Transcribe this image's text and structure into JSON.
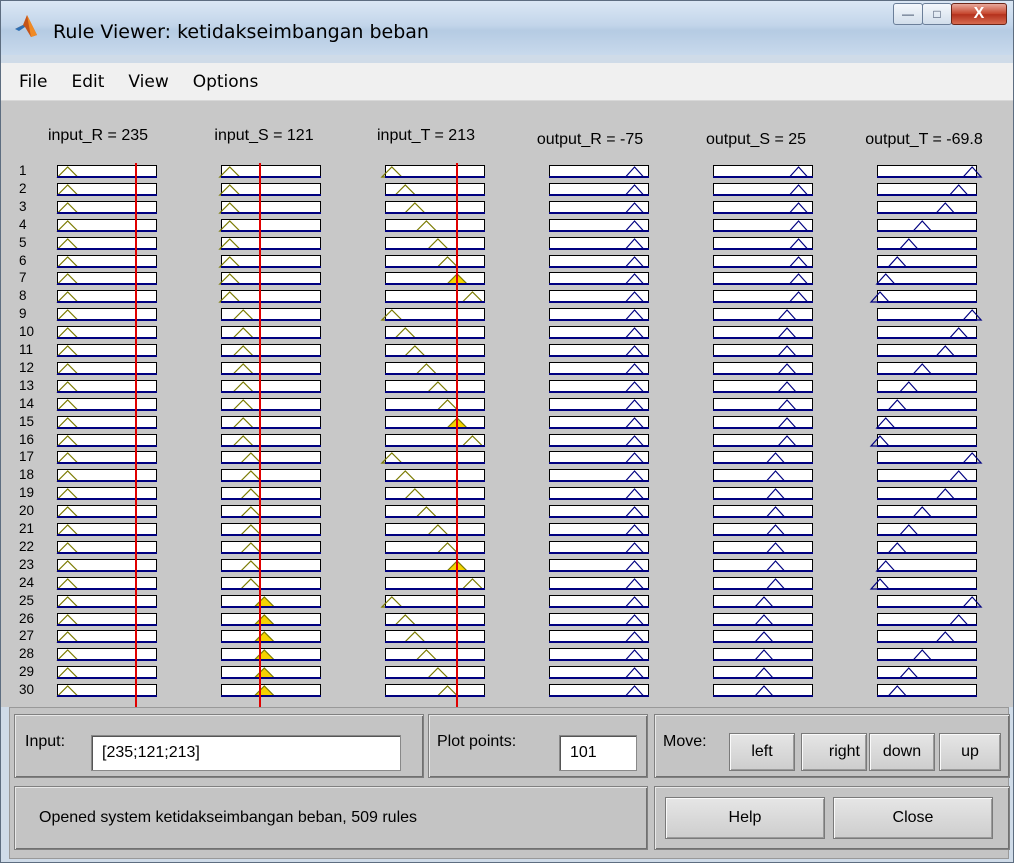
{
  "window": {
    "title": "Rule Viewer: ketidakseimbangan beban",
    "controls": {
      "minimize": "—",
      "maximize": "□",
      "close": "X"
    }
  },
  "menu": [
    "File",
    "Edit",
    "View",
    "Options"
  ],
  "columns": [
    {
      "title": "input_R = 235",
      "kind": "input",
      "line": 0.78
    },
    {
      "title": "input_S = 121",
      "kind": "input",
      "line": 0.38
    },
    {
      "title": "input_T = 213",
      "kind": "input",
      "line": 0.71
    },
    {
      "title": "output_R = -75",
      "kind": "output"
    },
    {
      "title": "output_S = 25",
      "kind": "output"
    },
    {
      "title": "output_T = -69.8",
      "kind": "output"
    }
  ],
  "rule_numbers": [
    "1",
    "2",
    "3",
    "4",
    "5",
    "6",
    "7",
    "8",
    "9",
    "10",
    "11",
    "12",
    "13",
    "14",
    "15",
    "16",
    "17",
    "18",
    "19",
    "20",
    "21",
    "22",
    "23",
    "24",
    "25",
    "26",
    "27",
    "28",
    "29",
    "30"
  ],
  "input_panel": {
    "input_label": "Input:",
    "input_value": "[235;121;213]",
    "plot_points_label": "Plot points:",
    "plot_points_value": "101",
    "move_label": "Move:",
    "move_buttons": [
      "left",
      "right",
      "down",
      "up"
    ]
  },
  "status_text": "Opened system ketidakseimbangan beban, 509 rules",
  "buttons": {
    "help": "Help",
    "close": "Close"
  },
  "colors": {
    "mf_line": "#7a7a00",
    "fired_fill": "#f5d300",
    "output_mf": "#000080",
    "input_marker": "#e00000"
  }
}
